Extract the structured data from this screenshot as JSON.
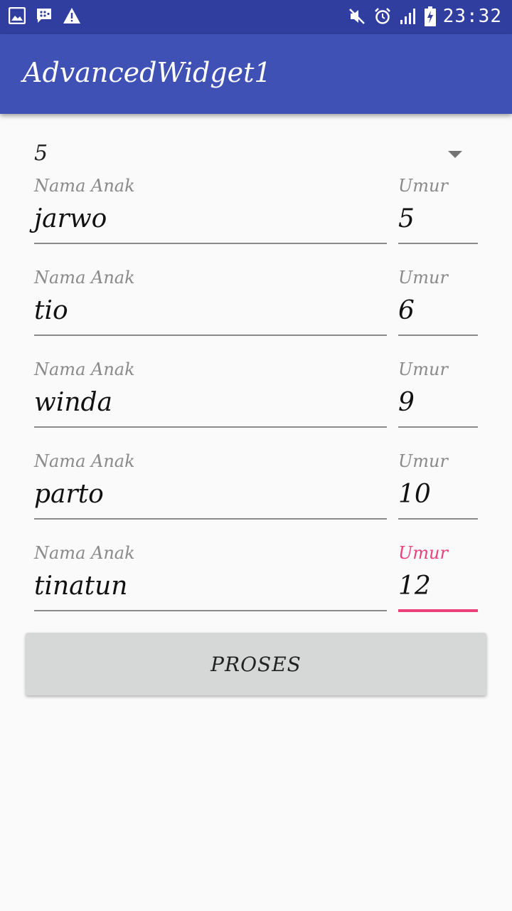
{
  "status_bar": {
    "time": "23:32",
    "icons_left": [
      "gallery-icon",
      "bbm-icon",
      "warning-icon"
    ],
    "icons_right": [
      "mute-icon",
      "alarm-icon",
      "signal-icon",
      "battery-charging-icon"
    ]
  },
  "app_bar": {
    "title": "AdvancedWidget1"
  },
  "spinner": {
    "selected": "5"
  },
  "rows": [
    {
      "name_label": "Nama Anak",
      "name_value": "jarwo",
      "age_label": "Umur",
      "age_value": "5"
    },
    {
      "name_label": "Nama Anak",
      "name_value": "tio",
      "age_label": "Umur",
      "age_value": "6"
    },
    {
      "name_label": "Nama Anak",
      "name_value": "winda",
      "age_label": "Umur",
      "age_value": "9"
    },
    {
      "name_label": "Nama Anak",
      "name_value": "parto",
      "age_label": "Umur",
      "age_value": "10"
    },
    {
      "name_label": "Nama Anak",
      "name_value": "tinatun",
      "age_label": "Umur",
      "age_value": "12"
    }
  ],
  "button": {
    "label": "PROSES"
  },
  "colors": {
    "status_bar": "#303f9f",
    "app_bar": "#3f51b5",
    "accent": "#ec407a",
    "button": "#d6d7d7"
  }
}
